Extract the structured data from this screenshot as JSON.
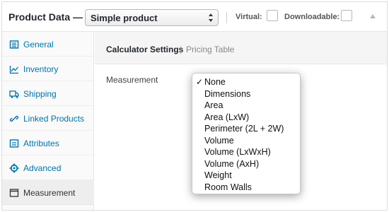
{
  "header": {
    "title": "Product Data —",
    "product_type": "Simple product",
    "virtual_label": "Virtual:",
    "downloadable_label": "Downloadable:",
    "virtual_checked": false,
    "downloadable_checked": false
  },
  "sidebar": {
    "items": [
      {
        "label": "General",
        "icon": "general-list-icon",
        "active": false
      },
      {
        "label": "Inventory",
        "icon": "inventory-chart-icon",
        "active": false
      },
      {
        "label": "Shipping",
        "icon": "shipping-truck-icon",
        "active": false
      },
      {
        "label": "Linked Products",
        "icon": "link-icon",
        "active": false
      },
      {
        "label": "Attributes",
        "icon": "attributes-list-icon",
        "active": false
      },
      {
        "label": "Advanced",
        "icon": "gear-icon",
        "active": false
      },
      {
        "label": "Measurement",
        "icon": "window-icon",
        "active": true
      }
    ]
  },
  "main": {
    "subnav_active": "Calculator Settings",
    "subnav_separator": "|",
    "subnav_link": "Pricing Table",
    "measurement_label": "Measurement"
  },
  "dropdown": {
    "selected": "None",
    "check_mark": "✓",
    "options": [
      "None",
      "Dimensions",
      "Area",
      "Area (LxW)",
      "Perimeter (2L + 2W)",
      "Volume",
      "Volume (LxWxH)",
      "Volume (AxH)",
      "Weight",
      "Room Walls"
    ]
  },
  "colors": {
    "link": "#0073aa",
    "sidebar_bg": "#fafafa",
    "active_tab_bg": "#eeeeee",
    "subnav_bg": "#f5f5f5"
  }
}
